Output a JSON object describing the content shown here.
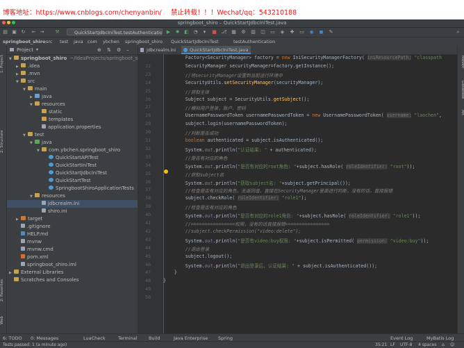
{
  "watermark": {
    "left": "博客地址：https://www.cnblogs.com/chenyanbin/",
    "right": "禁止转载！！！Wechat/qq：543210188"
  },
  "window": {
    "title": "springboot_shiro – QuickStartJdbcIniTest.java"
  },
  "toolbar": {
    "run_config": "QuickStartJdbcIniTest.testAuthentication"
  },
  "breadcrumb": [
    "springboot_shiro",
    "src",
    "test",
    "java",
    "com",
    "ybchen",
    "springboot_shiro",
    "QuickStartJdbcIniTest",
    "testAuthentication"
  ],
  "left_tabs": [
    "1: Project",
    "2: Structure",
    "2: Favorites",
    "Web"
  ],
  "right_tabs": [
    "Maven",
    "Database",
    "Art"
  ],
  "project": {
    "header": "Project",
    "tree": [
      {
        "label": "springboot_shiro",
        "suffix": "~/IdeaProjects/springboot_shiro",
        "indent": 0,
        "icon": "folder",
        "open": true,
        "bold": true
      },
      {
        "label": ".idea",
        "indent": 1,
        "icon": "folder"
      },
      {
        "label": ".mvn",
        "indent": 1,
        "icon": "folder"
      },
      {
        "label": "src",
        "indent": 1,
        "icon": "folder",
        "open": true
      },
      {
        "label": "main",
        "indent": 2,
        "icon": "folder",
        "open": true
      },
      {
        "label": "java",
        "indent": 3,
        "icon": "folder blue"
      },
      {
        "label": "resources",
        "indent": 3,
        "icon": "folder",
        "open": true
      },
      {
        "label": "static",
        "indent": 4,
        "icon": "folder",
        "leaf": true
      },
      {
        "label": "templates",
        "indent": 4,
        "icon": "folder",
        "leaf": true
      },
      {
        "label": "application.properties",
        "indent": 4,
        "icon": "file green",
        "leaf": true
      },
      {
        "label": "test",
        "indent": 2,
        "icon": "folder",
        "open": true
      },
      {
        "label": "java",
        "indent": 3,
        "icon": "folder green",
        "open": true
      },
      {
        "label": "com.ybchen.springboot_shiro",
        "indent": 4,
        "icon": "folder",
        "open": true
      },
      {
        "label": "QuickStartAPITest",
        "indent": 5,
        "icon": "cls",
        "leaf": true
      },
      {
        "label": "QuickStartIniTest",
        "indent": 5,
        "icon": "cls",
        "leaf": true
      },
      {
        "label": "QuickStartJdbcIniTest",
        "indent": 5,
        "icon": "cls",
        "leaf": true
      },
      {
        "label": "QuickStartTest",
        "indent": 5,
        "icon": "cls",
        "leaf": true
      },
      {
        "label": "SpringbootShiroApplicationTests",
        "indent": 5,
        "icon": "cls",
        "leaf": true
      },
      {
        "label": "resources",
        "indent": 3,
        "icon": "folder",
        "open": true
      },
      {
        "label": "jdbcrealm.ini",
        "indent": 4,
        "icon": "file",
        "leaf": true,
        "selected": true
      },
      {
        "label": "shiro.ini",
        "indent": 4,
        "icon": "file",
        "leaf": true
      },
      {
        "label": "target",
        "indent": 1,
        "icon": "folder orange"
      },
      {
        "label": ".gitignore",
        "indent": 1,
        "icon": "file",
        "leaf": true
      },
      {
        "label": "HELP.md",
        "indent": 1,
        "icon": "md",
        "leaf": true
      },
      {
        "label": "mvnw",
        "indent": 1,
        "icon": "file",
        "leaf": true
      },
      {
        "label": "mvnw.cmd",
        "indent": 1,
        "icon": "file",
        "leaf": true
      },
      {
        "label": "pom.xml",
        "indent": 1,
        "icon": "xml",
        "leaf": true
      },
      {
        "label": "springboot_shiro.iml",
        "indent": 1,
        "icon": "file",
        "leaf": true
      },
      {
        "label": "External Libraries",
        "indent": 0,
        "icon": "folder"
      },
      {
        "label": "Scratches and Consoles",
        "indent": 0,
        "icon": "folder",
        "leaf": true
      }
    ]
  },
  "editor": {
    "tabs": [
      "jdbcrealm.ini",
      "QuickStartJdbcIniTest.java"
    ],
    "lines": [
      {
        "n": "",
        "html": "        <span>Factory&lt;SecurityManager&gt; factory = </span><span class=\"kw\">new</span> IniSecurityManagerFactory( <span class=\"hint\">iniResourcePath:</span> <span class=\"str\">\"classpath</span>"
      },
      {
        "n": "22",
        "html": "        SecurityManager securityManager=factory.getInstance();"
      },
      {
        "n": "23",
        "html": "        <span class=\"cm\">//将securityManager设置到当前运行环境中</span>"
      },
      {
        "n": "24",
        "html": "        SecurityUtils.<span class=\"mth\">setSecurityManager</span>(securityManager);"
      },
      {
        "n": "25",
        "html": "        <span class=\"cm\">//获取主体</span>"
      },
      {
        "n": "26",
        "html": "        Subject subject = SecurityUtils.<span class=\"mth\">getSubject</span>();"
      },
      {
        "n": "27",
        "html": "        <span class=\"cm\">//模拟用户登录，账户、密码</span>"
      },
      {
        "n": "28",
        "html": "        UsernamePasswordToken usernamePasswordToken = <span class=\"kw\">new</span> UsernamePasswordToken( <span class=\"hint\">username:</span> <span class=\"str\">\"laochen\"</span>,"
      },
      {
        "n": "29",
        "html": "        subject.login(usernamePasswordToken);"
      },
      {
        "n": "30",
        "html": "        <span class=\"cm\">//判断是否成功</span>"
      },
      {
        "n": "31",
        "html": "        <span class=\"kw\">boolean</span> authenticated = subject.isAuthenticated();"
      },
      {
        "n": "32",
        "html": "        System.<span class=\"fld\">out</span>.println(<span class=\"str\">\"认证结果: \"</span> + authenticated);"
      },
      {
        "n": "33",
        "html": "        <span class=\"cm\">//是否有对应的角色</span>"
      },
      {
        "n": "34",
        "html": "        System.<span class=\"fld\">out</span>.println(<span class=\"str\">\"是否有对应的root角色: \"</span>+subject.hasRole( <span class=\"hint\">roleIdentifier:</span> <span class=\"str\">\"root\"</span>));"
      },
      {
        "n": "35",
        "html": "        <span class=\"cm\">//获取subject名</span>"
      },
      {
        "n": "36",
        "html": "        System.<span class=\"fld\">out</span>.println(<span class=\"str\">\"获取subject名: \"</span>+subject.getPrincipal());"
      },
      {
        "n": "37",
        "html": "        <span class=\"cm\">//检查是否有对应的角色，无返回值，直接在SecurityManager里面进行判断，没有的话，直接报错</span>"
      },
      {
        "n": "38",
        "html": "        subject.checkRole( <span class=\"hint\">roleIdentifier:</span> <span class=\"str\">\"role1\"</span>);"
      },
      {
        "n": "39",
        "html": "        <span class=\"cm\">//检查是否有对应的角色</span>"
      },
      {
        "n": "40",
        "html": "        System.<span class=\"fld\">out</span>.println(<span class=\"str\">\"是否有对应的role1角色: \"</span>+subject.hasRole( <span class=\"hint\">roleIdentifier:</span> <span class=\"str\">\"role1\"</span>));"
      },
      {
        "n": "41",
        "html": "        <span class=\"cm\">//================权限，没有的话直接报错================</span>"
      },
      {
        "n": "42",
        "html": "        <span class=\"cm\">//subject.checkPermission(\"video:delete\");</span>"
      },
      {
        "n": "43",
        "html": "        System.<span class=\"fld\">out</span>.println(<span class=\"str\">\"是否有video:buy权限: \"</span>+subject.isPermitted( <span class=\"hint\">permission:</span> <span class=\"str\">\"video:buy\"</span>));"
      },
      {
        "n": "44",
        "html": "        <span class=\"cm\">//退出登录</span>"
      },
      {
        "n": "45",
        "html": "        subject.logout();"
      },
      {
        "n": "46",
        "html": "        System.<span class=\"fld\">out</span>.println(<span class=\"str\">\"退出登录后，认证结果: \"</span> + subject.isAuthenticated());"
      },
      {
        "n": "47",
        "html": "    }"
      },
      {
        "n": "48",
        "html": "}"
      },
      {
        "n": "49",
        "html": ""
      },
      {
        "n": "50",
        "html": ""
      }
    ]
  },
  "bottom_tabs": [
    "6: TODO",
    "0: Messages",
    "LuaCheck",
    "Terminal",
    "Build",
    "Java Enterprise",
    "Spring",
    "Event Log",
    "MyBatis Log"
  ],
  "status": {
    "left": "Tests passed: 1 (a minute ago)",
    "pos": "35:21",
    "lf": "LF",
    "enc": "UTF-8",
    "indent": "4 spaces"
  }
}
